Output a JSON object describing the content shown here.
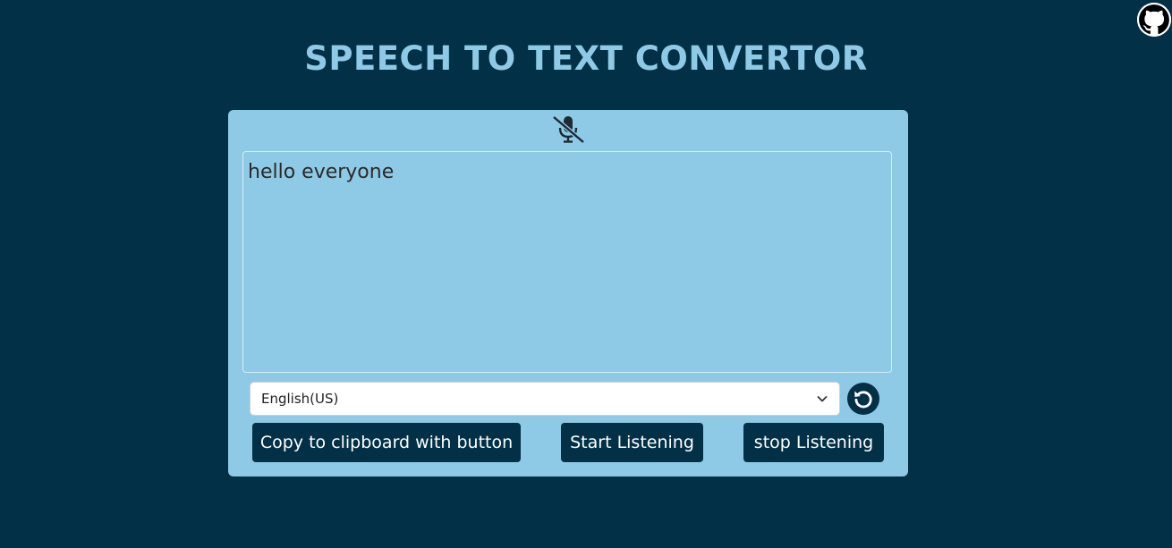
{
  "header": {
    "title": "SPEECH TO TEXT CONVERTOR",
    "github_icon": "github-icon"
  },
  "main": {
    "mic_icon": "microphone-off-icon",
    "transcript": "hello everyone",
    "language": {
      "selected": "English(US)",
      "dropdown_icon": "chevron-down-icon"
    },
    "reset_icon": "rotate-ccw-icon",
    "buttons": {
      "copy": "Copy to clipboard with button",
      "start": "Start Listening",
      "stop": "stop Listening"
    }
  },
  "colors": {
    "background": "#023047",
    "card": "#8ecae6",
    "accent": "#8ecae6",
    "button": "#023047"
  }
}
